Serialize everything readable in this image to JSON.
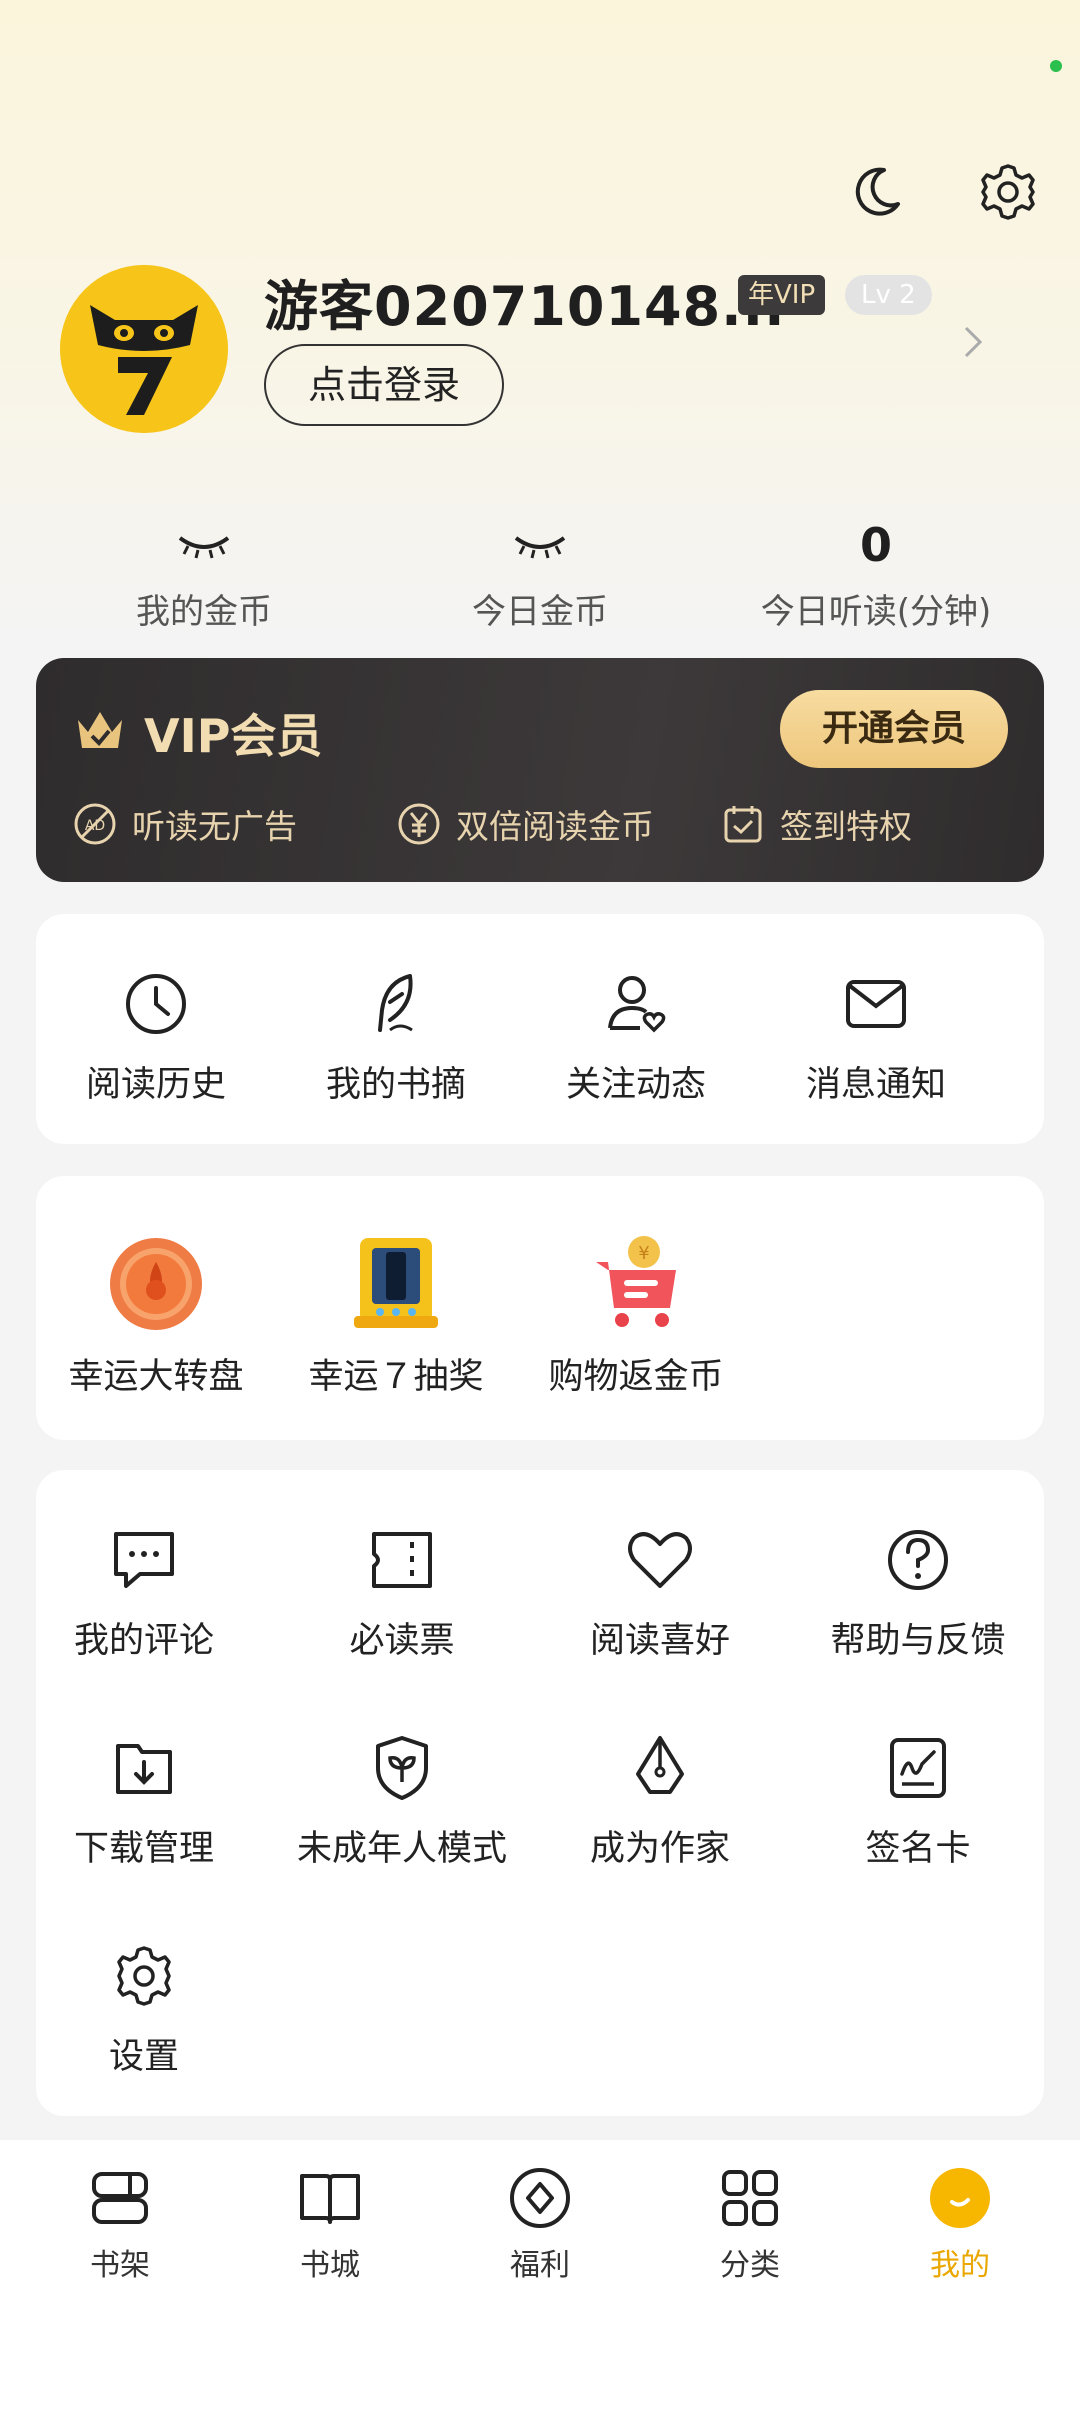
{
  "header": {
    "username": "游客020710148...",
    "vip_badge": "年VIP",
    "level_badge": "Lv 2",
    "login_button": "点击登录",
    "icons": [
      "moon-icon",
      "gear-icon",
      "chevron-right-icon"
    ]
  },
  "stats": [
    {
      "value_icon": "closed-eye-icon",
      "label": "我的金币"
    },
    {
      "value_icon": "closed-eye-icon",
      "label": "今日金币"
    },
    {
      "value": "0",
      "label": "今日听读(分钟)"
    }
  ],
  "vip_card": {
    "title": "VIP会员",
    "button": "开通会员",
    "perks": [
      {
        "icon": "no-ads-icon",
        "label": "听读无广告"
      },
      {
        "icon": "yuan-icon",
        "label": "双倍阅读金币"
      },
      {
        "icon": "calendar-check-icon",
        "label": "签到特权"
      }
    ],
    "colors": {
      "accent": "#f2dcb1",
      "button": "#eec77c"
    }
  },
  "quick_menu": [
    {
      "icon": "clock-icon",
      "label": "阅读历史"
    },
    {
      "icon": "feather-icon",
      "label": "我的书摘"
    },
    {
      "icon": "user-heart-icon",
      "label": "关注动态"
    },
    {
      "icon": "mail-icon",
      "label": "消息通知"
    }
  ],
  "promotions": [
    {
      "icon": "lucky-wheel-icon",
      "label": "幸运大转盘"
    },
    {
      "icon": "lottery-machine-icon",
      "label": "幸运７抽奖"
    },
    {
      "icon": "shopping-cart-icon",
      "label": "购物返金币"
    }
  ],
  "tools": [
    {
      "icon": "comment-icon",
      "label": "我的评论"
    },
    {
      "icon": "ticket-icon",
      "label": "必读票"
    },
    {
      "icon": "heart-icon",
      "label": "阅读喜好"
    },
    {
      "icon": "question-icon",
      "label": "帮助与反馈"
    },
    {
      "icon": "download-icon",
      "label": "下载管理"
    },
    {
      "icon": "shield-leaf-icon",
      "label": "未成年人模式"
    },
    {
      "icon": "pen-nib-icon",
      "label": "成为作家"
    },
    {
      "icon": "signature-icon",
      "label": "签名卡"
    },
    {
      "icon": "gear-icon",
      "label": "设置"
    }
  ],
  "bottom_nav": [
    {
      "icon": "bookshelf-icon",
      "label": "书架"
    },
    {
      "icon": "book-open-icon",
      "label": "书城"
    },
    {
      "icon": "gift-circle-icon",
      "label": "福利"
    },
    {
      "icon": "grid-icon",
      "label": "分类"
    },
    {
      "icon": "smile-avatar-icon",
      "label": "我的",
      "active": true
    }
  ],
  "colors": {
    "active_tab": "#e9a700",
    "avatar_bg": "#f7c51a"
  }
}
